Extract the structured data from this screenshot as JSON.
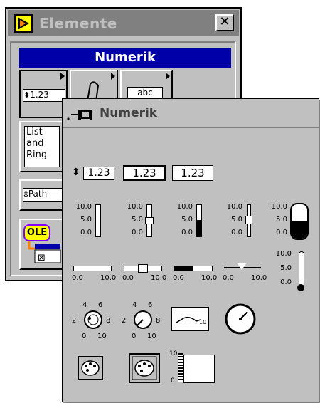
{
  "elemente_window": {
    "title": "Elemente",
    "close_label": "✕",
    "palette_header": "Numerik",
    "palette_items": [
      {
        "label": "1.23",
        "icon": "numeric-control-icon"
      },
      {
        "label": "",
        "icon": "boolean-icon"
      },
      {
        "label": "abc",
        "icon": "string-icon"
      },
      {
        "label": "List and Ring",
        "icon": "list-ring-icon"
      },
      {
        "label": "Path",
        "icon": "path-icon"
      },
      {
        "label": "OLE",
        "icon": "ole-refnum-icon"
      }
    ]
  },
  "numerik_palette": {
    "title": "Numerik",
    "digital": [
      {
        "name": "digital-control",
        "label": "1.23"
      },
      {
        "name": "digital-indicator-sunken",
        "label": "1.23"
      },
      {
        "name": "digital-indicator",
        "label": "1.23"
      }
    ],
    "vertical_scale": [
      "10.0",
      "5.0",
      "0.0"
    ],
    "horizontal_scale": [
      "0.0",
      "10.0"
    ],
    "knob_scale": [
      "4",
      "6",
      "2",
      "8",
      "0",
      "10"
    ],
    "graph_ymax": "10",
    "graph_ymin": "0"
  }
}
